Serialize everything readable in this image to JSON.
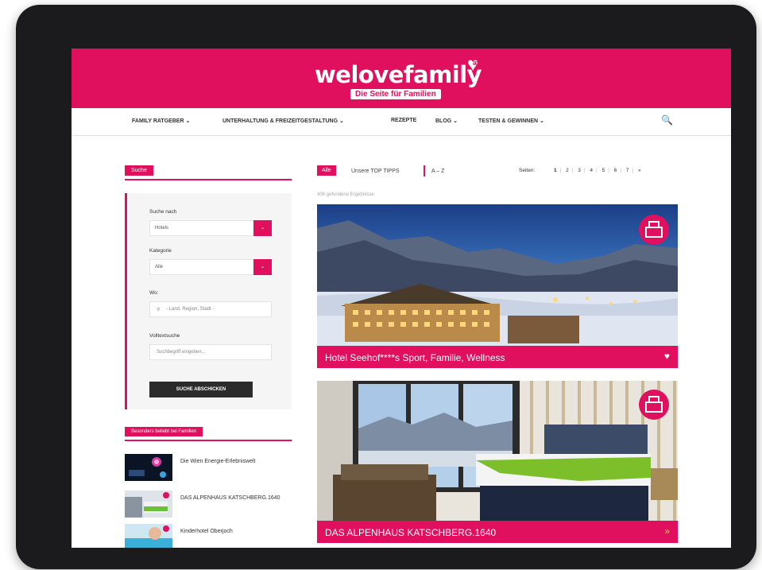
{
  "brand": {
    "logo_text": "welovefamily",
    "logo_badge": "at",
    "tagline": "Die Seite für Familien"
  },
  "nav": {
    "items": [
      "FAMILY RATGEBER ⌄",
      "UNTERHALTUNG & FREIZEITGESTALTUNG ⌄",
      "REZEPTE",
      "BLOG ⌄",
      "TESTEN & GEWINNEN ⌄"
    ],
    "search_icon": "🔍"
  },
  "sidebar": {
    "search_tab": "Suche",
    "fields": [
      {
        "label": "Suche nach",
        "value": "Hotels",
        "button": "⌄"
      },
      {
        "label": "Kategorie",
        "value": "Alle",
        "button": "⌄"
      }
    ],
    "where_label": "Wo:",
    "where_placeholder": "- Land, Region, Stadt -",
    "fulltext_label": "Volltextsuche",
    "fulltext_placeholder": "Suchbegriff eingeben...",
    "submit_label": "SUCHE ABSCHICKEN",
    "recent_tab": "Besonders beliebt bei Familien",
    "recent_items": [
      {
        "title": "Die Wien Energie-Erlebniswelt"
      },
      {
        "title": "DAS ALPENHAUS KATSCHBERG.1640"
      },
      {
        "title": "Kinderhotel Oberjoch"
      }
    ]
  },
  "filters": {
    "all_label": "Alle",
    "tips_label": "Unsere TOP TIPPS",
    "range_label": "A – Z",
    "pages_label": "Seiten:",
    "pages": [
      "1",
      "2",
      "3",
      "4",
      "5",
      "6",
      "7",
      "»"
    ],
    "result_count": "406 gefundene Ergebnisse"
  },
  "cards": [
    {
      "title": "Hotel Seehof****s Sport, Familie, Wellness",
      "icon": "♥"
    },
    {
      "title": "DAS ALPENHAUS KATSCHBERG.1640",
      "icon": "»"
    }
  ],
  "colors": {
    "brand": "#e0105e",
    "bezel": "#1b1b1d",
    "dark_button": "#2b2b2b"
  }
}
